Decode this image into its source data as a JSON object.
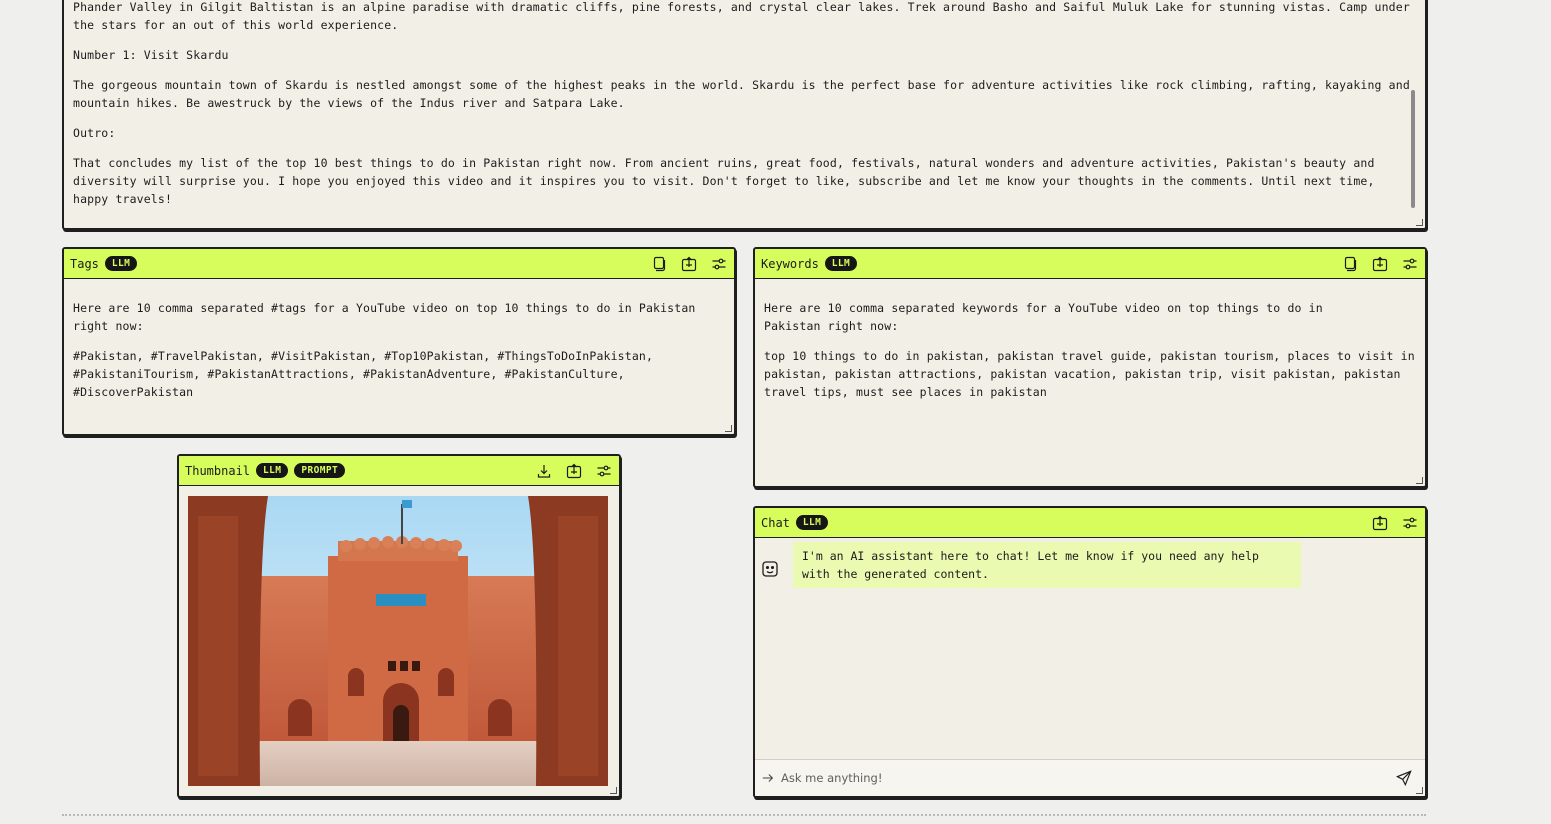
{
  "script": {
    "paragraphs": [
      "Phander Valley in Gilgit Baltistan is an alpine paradise with dramatic cliffs, pine forests, and crystal clear lakes. Trek around Basho and Saiful Muluk Lake for stunning vistas. Camp under the stars for an out of this world experience.",
      "Number 1: Visit Skardu",
      "The gorgeous mountain town of Skardu is nestled amongst some of the highest peaks in the world. Skardu is the perfect base for adventure activities like rock climbing, rafting, kayaking and mountain hikes. Be awestruck by the views of the Indus river and Satpara Lake.",
      "Outro:",
      "That concludes my list of the top 10 best things to do in Pakistan right now. From ancient ruins, great food, festivals, natural wonders and adventure activities, Pakistan's beauty and diversity will surprise you. I hope you enjoyed this video and it inspires you to visit. Don't forget to like, subscribe and let me know your thoughts in the comments. Until next time, happy travels!"
    ]
  },
  "tags": {
    "title": "Tags",
    "badge": "LLM",
    "intro": "Here are 10 comma separated #tags for a YouTube video on top 10 things to do in Pakistan right now:",
    "body": "#Pakistan, #TravelPakistan, #VisitPakistan, #Top10Pakistan, #ThingsToDoInPakistan, #PakistaniTourism, #PakistanAttractions, #PakistanAdventure, #PakistanCulture, #DiscoverPakistan",
    "icons": [
      "copy-icon",
      "export-icon",
      "settings-icon"
    ]
  },
  "keywords": {
    "title": "Keywords",
    "badge": "LLM",
    "intro": "Here are 10 comma separated keywords for a YouTube video on top things to do in Pakistan right now:",
    "body": "top 10 things to do in pakistan, pakistan travel guide, pakistan tourism, places to visit in pakistan, pakistan attractions, pakistan vacation, pakistan trip, visit pakistan, pakistan travel tips, must see places in pakistan",
    "icons": [
      "copy-icon",
      "export-icon",
      "settings-icon"
    ]
  },
  "thumbnail": {
    "title": "Thumbnail",
    "badges": [
      "LLM",
      "PROMPT"
    ],
    "icons": [
      "download-icon",
      "export-icon",
      "settings-icon"
    ]
  },
  "chat": {
    "title": "Chat",
    "badge": "LLM",
    "message": "I'm an AI assistant here to chat! Let me know if you need any help with the generated content.",
    "placeholder": "Ask me anything!",
    "icons": [
      "export-icon",
      "settings-icon",
      "send-icon"
    ]
  },
  "colors": {
    "header_accent": "#d6fd5c",
    "panel_bg": "#f2f0e6",
    "badge_bg": "#161616",
    "bubble_bg": "#eafab1"
  }
}
